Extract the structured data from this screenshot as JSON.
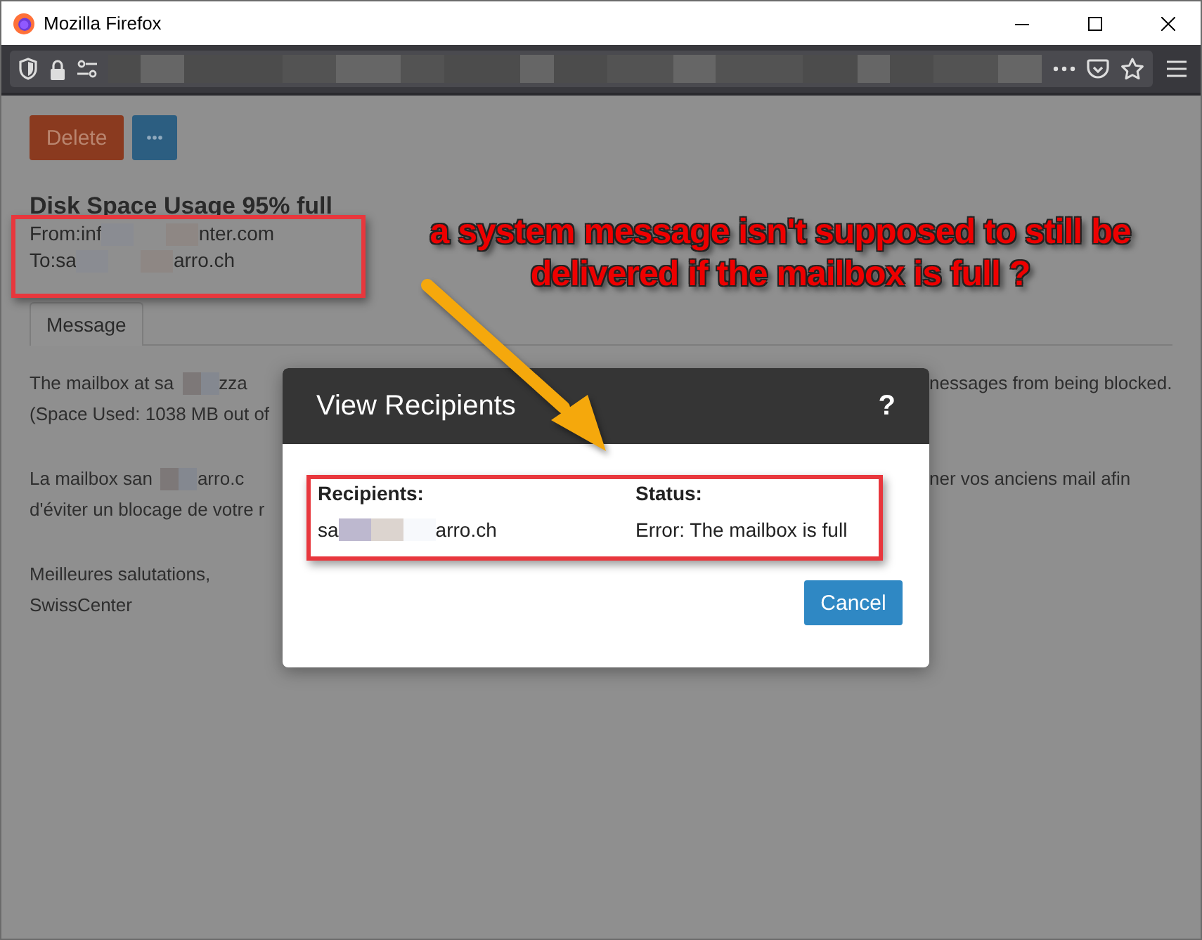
{
  "window": {
    "title": "Mozilla Firefox"
  },
  "actions": {
    "delete": "Delete"
  },
  "email": {
    "subject": "Disk Space Usage 95% full",
    "from": {
      "start": "From:inf",
      "end": "nter.com"
    },
    "to": {
      "start": "To:sa",
      "end": "arro.ch"
    }
  },
  "tabs": [
    {
      "label": "Message",
      "selected": true
    }
  ],
  "paragraphs": [
    [
      {
        "left": "The mailbox at sa",
        "left_end": "zza",
        "right": "nessages from being blocked."
      },
      {
        "left": "(Space Used: 1038 MB out of"
      }
    ],
    [
      {
        "left": "La mailbox san",
        "left_end": "arro.c",
        "right": "ner vos anciens mail afin"
      },
      {
        "left": "d'éviter un blocage de votre r"
      }
    ],
    [
      {
        "left": "Meilleures salutations,"
      },
      {
        "left": "SwissCenter"
      }
    ]
  ],
  "dialog": {
    "title": "View Recipients",
    "help": "?",
    "columns": [
      {
        "heading": "Recipients:",
        "start": "sa",
        "end": "arro.ch"
      },
      {
        "heading": "Status:",
        "start": "Error: The mailbox is full"
      }
    ],
    "button": "Cancel"
  },
  "annotation": {
    "lines": [
      "a system message isn't supposed to still be",
      "delivered if the mailbox is full ?"
    ]
  }
}
